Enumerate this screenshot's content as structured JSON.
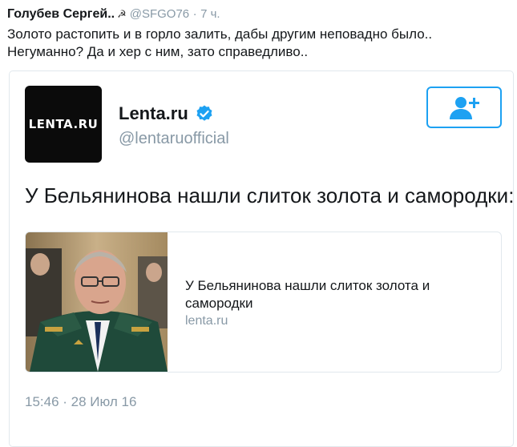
{
  "outer_tweet": {
    "author_name": "Голубев Сергей..",
    "author_emoji": "☭",
    "handle": "@SFGO76",
    "separator": "·",
    "time": "7 ч.",
    "text_line1": "Золото растопить и в горло залить, дабы другим неповадно было..",
    "text_line2": "Негуманно? Да и хер с ним, зато справедливо.."
  },
  "embedded_tweet": {
    "avatar_text": "LENTA.RU",
    "account_name": "Lenta.ru",
    "handle": "@lentaruofficial",
    "text": "У Бельянинова нашли слиток золота и самородки:",
    "link_card": {
      "title": "У Бельянинова нашли слиток золота и самородки",
      "domain": "lenta.ru"
    },
    "timestamp": "15:46 · 28 Июл 16"
  },
  "colors": {
    "accent": "#1da1f2",
    "muted_text": "#8899a6",
    "border": "#e1e8ed"
  },
  "icons": [
    "verified-icon",
    "follow-user-icon",
    "hammer-sickle-icon"
  ]
}
